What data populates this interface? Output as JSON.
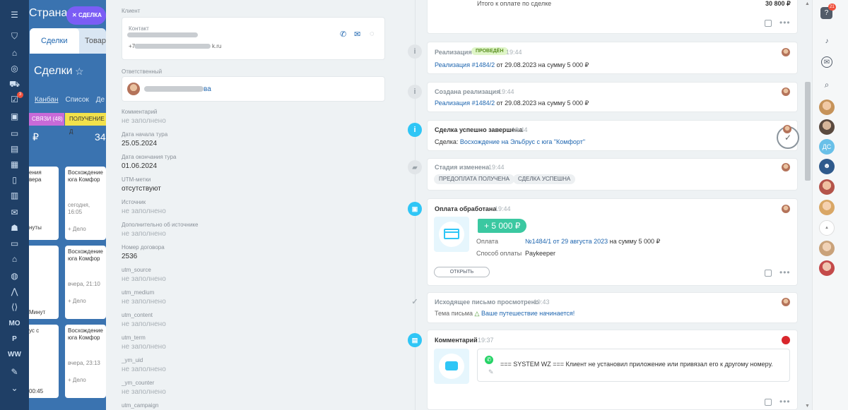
{
  "left_rail": {
    "badge": "3",
    "items": [
      "MO",
      "P",
      "WW"
    ]
  },
  "crm_bg": {
    "app_title": "Страна",
    "chip_label": "СДЕЛКА",
    "tab_deals": "Сделки",
    "tab_goods": "Товары",
    "page_title": "Сделки",
    "view_kanban": "Канбан",
    "view_list": "Список",
    "view_more": "Де",
    "stage1": "СВЯЗИ",
    "stage1_count": "(48)",
    "stage2": "ПОЛУЧЕНИЕ Д",
    "sum1": "₽",
    "sum2": "34",
    "cards": [
      {
        "title": "Восхождение юга Комфор",
        "time": "сегодня, 16:05",
        "deal": "+ Дело"
      },
      {
        "title": "Восхождение юга Комфор",
        "time": "вчера, 21:10",
        "deal": "+ Дело"
      },
      {
        "title": "Восхождение юга Комфор",
        "time": "вчера, 23:13",
        "deal": "+ Дело"
      }
    ],
    "left_cards": [
      {
        "line1": "ения",
        "line2": "вера",
        "foot": "нуты"
      },
      {
        "line1": "Минут",
        "line2": "",
        "foot": ""
      },
      {
        "line1": "ус с",
        "line2": "",
        "foot": "00:45"
      }
    ]
  },
  "fields": {
    "client_label": "Клиент",
    "contact_label": "Контакт",
    "contact_phone": "+7",
    "contact_email_tail": "k.ru",
    "responsible_label": "Ответственный",
    "responsible_tail": "ва",
    "rows": [
      {
        "label": "Комментарий",
        "value": "не заполнено",
        "empty": true
      },
      {
        "label": "Дата начала тура",
        "value": "25.05.2024",
        "empty": false
      },
      {
        "label": "Дата окончания тура",
        "value": "01.06.2024",
        "empty": false
      },
      {
        "label": "UTM-метки",
        "value": "отсутствуют",
        "empty": false
      },
      {
        "label": "Источник",
        "value": "не заполнено",
        "empty": true
      },
      {
        "label": "Дополнительно об источнике",
        "value": "не заполнено",
        "empty": true
      },
      {
        "label": "Номер договора",
        "value": "2536",
        "empty": false
      },
      {
        "label": "utm_source",
        "value": "не заполнено",
        "empty": true
      },
      {
        "label": "utm_medium",
        "value": "не заполнено",
        "empty": true
      },
      {
        "label": "utm_content",
        "value": "не заполнено",
        "empty": true
      },
      {
        "label": "utm_term",
        "value": "не заполнено",
        "empty": true
      },
      {
        "label": "_ym_uid",
        "value": "не заполнено",
        "empty": true
      },
      {
        "label": "_ym_counter",
        "value": "не заполнено",
        "empty": true
      },
      {
        "label": "utm_campaign",
        "value": "",
        "empty": true
      }
    ]
  },
  "timeline": {
    "total_label": "Итого к оплате по сделке",
    "total_value": "30 800 ₽",
    "e1": {
      "title": "Реализация",
      "badge": "ПРОВЕДЁН",
      "time": "19:44",
      "link": "Реализация #1484/2",
      "rest": "от 29.08.2023 на сумму 5 000 ₽"
    },
    "e2": {
      "title": "Создана реализация",
      "time": "19:44",
      "link": "Реализация #1484/2",
      "rest": "от 29.08.2023 на сумму 5 000 ₽"
    },
    "e3": {
      "title": "Сделка успешно завершена",
      "time": "19:44",
      "prefix": "Сделка:",
      "link": "Восхождение на Эльбрус с юга \"Комфорт\""
    },
    "e4": {
      "title": "Стадия изменена",
      "time": "19:44",
      "from": "ПРЕДОПЛАТА ПОЛУЧЕНА",
      "arrow": "→",
      "to": "СДЕЛКА УСПЕШНА"
    },
    "e5": {
      "title": "Оплата обработана",
      "time": "19:44",
      "amount": "+ 5 000 ₽",
      "pay_label": "Оплата",
      "pay_link": "№1484/1 от 29 августа 2023",
      "pay_rest": "на сумму 5 000 ₽",
      "method_label": "Способ оплаты",
      "method_value": "Paykeeper",
      "open_btn": "ОТКРЫТЬ"
    },
    "e6": {
      "title": "Исходящее письмо просмотрено",
      "time": "19:43",
      "subject_label": "Тема письма",
      "subject_link": "Ваше путешествие начинается!"
    },
    "e7": {
      "title": "Комментарий",
      "time": "19:37",
      "text": "=== SYSTEM WZ === Клиент не установил приложение или привязал его к другому номеру."
    }
  },
  "right_bar": {
    "notif_badge": "21",
    "avatar_initials": "ДС"
  },
  "colors": {
    "accent": "#2067b0",
    "success_badge": "#dff5c8",
    "amount_green": "#3bc8a1",
    "info_blue": "#2fc6f6"
  }
}
